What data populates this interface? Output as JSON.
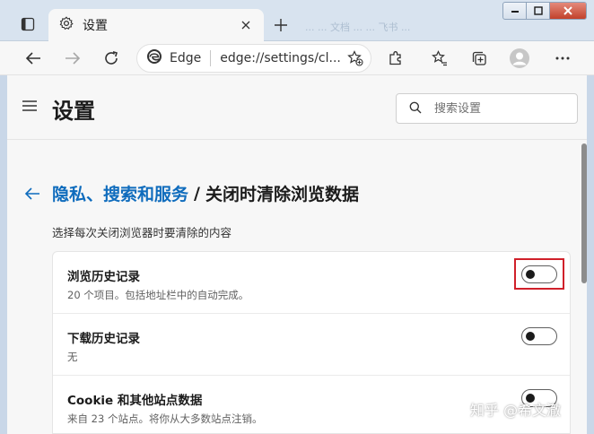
{
  "browser": {
    "tab_title": "设置",
    "background_tabs_text": "... ... 文档  ... ... 飞书  ...",
    "address_label": "Edge",
    "address_url": "edge://settings/cl..."
  },
  "settings": {
    "title": "设置",
    "search_placeholder": "搜索设置",
    "breadcrumb_parent": "隐私、搜索和服务",
    "breadcrumb_separator": "/",
    "breadcrumb_current": "关闭时清除浏览数据",
    "subtitle": "选择每次关闭浏览器时要清除的内容",
    "items": [
      {
        "title": "浏览历史记录",
        "desc": "20 个项目。包括地址栏中的自动完成。",
        "enabled": false
      },
      {
        "title": "下载历史记录",
        "desc": "无",
        "enabled": false
      },
      {
        "title": "Cookie 和其他站点数据",
        "desc": "来自 23 个站点。将你从大多数站点注销。",
        "enabled": false
      }
    ]
  },
  "watermark": "知乎 @希文澈",
  "colors": {
    "accent": "#0f6cbd",
    "highlight_box": "#d0202a",
    "page_bg": "#f7f7f7",
    "frame_bg": "#d8e3ef"
  }
}
